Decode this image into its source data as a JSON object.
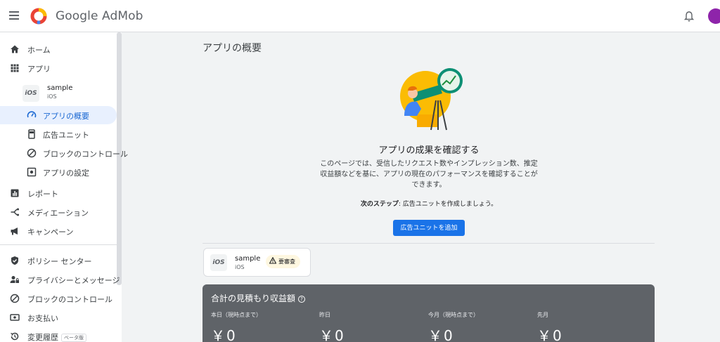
{
  "header": {
    "brand": "Google AdMob"
  },
  "sidebar": {
    "home": "ホーム",
    "apps": "アプリ",
    "app": {
      "name": "sample",
      "platform": "iOS",
      "badge": "iOS"
    },
    "sub_overview": "アプリの概要",
    "sub_adunits": "広告ユニット",
    "sub_block": "ブロックのコントロール",
    "sub_settings": "アプリの設定",
    "reports": "レポート",
    "mediation": "メディエーション",
    "campaigns": "キャンペーン",
    "policy": "ポリシー センター",
    "privacy": "プライバシーとメッセージ",
    "block": "ブロックのコントロール",
    "payments": "お支払い",
    "history": "変更履歴",
    "history_badge": "ベータ版"
  },
  "main": {
    "page_title": "アプリの概要",
    "hero_title": "アプリの成果を確認する",
    "hero_desc": "このページでは、受信したリクエスト数やインプレッション数、推定収益額などを基に、アプリの現在のパフォーマンスを確認することができます。",
    "next_step_label": "次のステップ",
    "next_step_text": ": 広告ユニットを作成しましょう。",
    "add_button": "広告ユニットを追加",
    "card": {
      "badge": "iOS",
      "name": "sample",
      "platform": "iOS",
      "status": "要審査"
    },
    "earnings": {
      "title": "合計の見積もり収益額",
      "columns": [
        {
          "label": "本日（現時点まで）",
          "value": "￥0"
        },
        {
          "label": "昨日",
          "value": "￥0"
        },
        {
          "label": "今月（現時点まで）",
          "value": "￥0"
        },
        {
          "label": "先月",
          "value": "￥0"
        }
      ]
    }
  },
  "colors": {
    "accent": "#1a73e8",
    "active_bg": "#e8f0fe",
    "earnings_bg": "#5f6368"
  }
}
